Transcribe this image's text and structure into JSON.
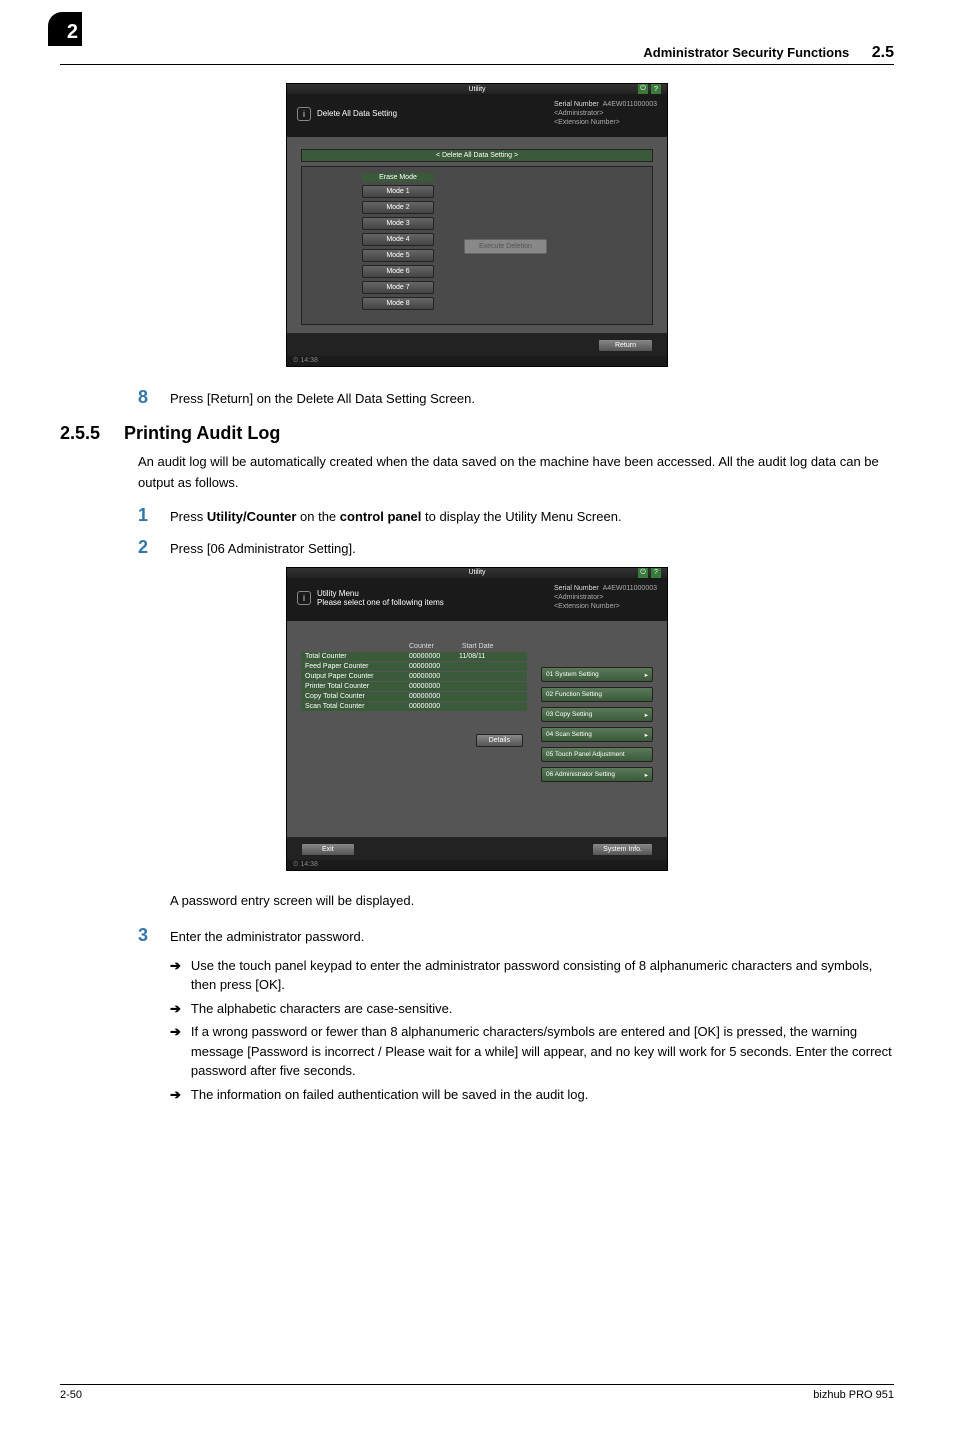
{
  "chapter_badge": "2",
  "header": {
    "title": "Administrator Security Functions",
    "section": "2.5"
  },
  "step8": {
    "num": "8",
    "text": "Press [Return] on the Delete All Data Setting Screen."
  },
  "section": {
    "num": "2.5.5",
    "title": "Printing Audit Log"
  },
  "body_intro": "An audit log will be automatically created when the data saved on the machine have been accessed. All the audit log data can be output as follows.",
  "step1": {
    "num": "1",
    "pre": "Press ",
    "b1": "Utility/Counter",
    "mid": " on the ",
    "b2": "control panel",
    "post": " to display the Utility Menu Screen."
  },
  "step2": {
    "num": "2",
    "text": "Press [06 Administrator Setting]."
  },
  "post_shot2": "A password entry screen will be displayed.",
  "step3": {
    "num": "3",
    "text": "Enter the administrator password.",
    "subs": [
      "Use the touch panel keypad to enter the administrator password consisting of 8 alphanumeric characters and symbols, then press [OK].",
      "The alphabetic characters are case-sensitive.",
      "If a wrong password or fewer than 8 alphanumeric characters/symbols are entered and [OK] is pressed, the warning message [Password is incorrect / Please wait for a while] will appear, and no key will work for 5 seconds. Enter the correct password after five seconds.",
      "The information on failed authentication will be saved in the audit log."
    ]
  },
  "footer": {
    "page": "2-50",
    "product": "bizhub PRO 951"
  },
  "shot_common": {
    "utility": "Utility",
    "serial_label": "Serial Number",
    "serial_value": "A4EW011000003",
    "admin": "<Administrator>",
    "ext": "<Extension Number>",
    "time": "14:38",
    "info_icon": "i",
    "power_icon": "⏻",
    "help_icon": "?"
  },
  "shot1": {
    "hdr_title": "Delete All Data Setting",
    "panel_title": "< Delete All Data Setting >",
    "erase_label": "Erase Mode",
    "modes": [
      "Mode 1",
      "Mode 2",
      "Mode 3",
      "Mode 4",
      "Mode 5",
      "Mode 6",
      "Mode 7",
      "Mode 8"
    ],
    "execute": "Execute Deletion",
    "return": "Return"
  },
  "shot2": {
    "hdr_line1": "Utility Menu",
    "hdr_line2": "Please select one of following items",
    "th_counter": "Counter",
    "th_date": "Start Date",
    "rows": [
      {
        "label": "Total Counter",
        "count": "00000000",
        "date": "11/08/11"
      },
      {
        "label": "Feed Paper Counter",
        "count": "00000000",
        "date": ""
      },
      {
        "label": "Output Paper Counter",
        "count": "00000000",
        "date": ""
      },
      {
        "label": "Printer Total Counter",
        "count": "00000000",
        "date": ""
      },
      {
        "label": "Copy Total Counter",
        "count": "00000000",
        "date": ""
      },
      {
        "label": "Scan Total Counter",
        "count": "00000000",
        "date": ""
      }
    ],
    "details": "Details",
    "menu": [
      {
        "label": "01 System Setting",
        "caret": true
      },
      {
        "label": "02 Function Setting",
        "caret": false
      },
      {
        "label": "03 Copy Setting",
        "caret": true
      },
      {
        "label": "04 Scan Setting",
        "caret": true
      },
      {
        "label": "05 Touch Panel Adjustment",
        "caret": false
      },
      {
        "label": "06 Administrator Setting",
        "caret": true
      }
    ],
    "exit": "Exit",
    "sysinfo": "System Info."
  }
}
